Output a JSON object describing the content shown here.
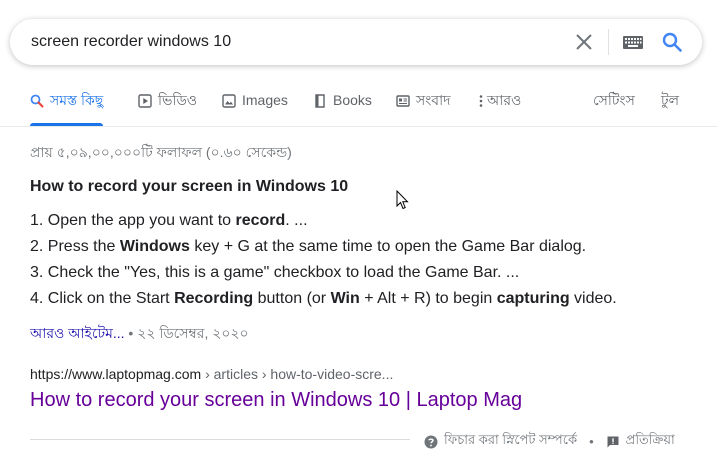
{
  "search": {
    "query": "screen recorder windows 10"
  },
  "tabs": [
    {
      "label": "সমস্ত কিছু",
      "icon": "search-icon"
    },
    {
      "label": "ভিডিও",
      "icon": "video-icon"
    },
    {
      "label": "Images",
      "icon": "image-icon"
    },
    {
      "label": "Books",
      "icon": "book-icon"
    },
    {
      "label": "সংবাদ",
      "icon": "news-icon"
    },
    {
      "label": "আরও",
      "icon": "more-vert-icon"
    }
  ],
  "tools": {
    "settings": "সেটিংস",
    "tools": "টুল"
  },
  "stats": "প্রায় ৫,০৯,০০,০০০টি ফলাফল (০.৬০ সেকেন্ড)",
  "snippet": {
    "title_parts": [
      "How to ",
      "record",
      " your ",
      "screen",
      " in ",
      "Windows 10"
    ],
    "steps": [
      [
        "1. Open the app you want to ",
        "record",
        ". ..."
      ],
      [
        "2. Press the ",
        "Windows",
        " key + G at the same time to open the Game Bar dialog."
      ],
      [
        "3. Check the \"Yes, this is a game\" checkbox to load the Game Bar. ..."
      ],
      [
        "4. Click on the Start ",
        "Recording",
        " button (or ",
        "Win",
        " + Alt + R) to begin ",
        "capturing",
        " video."
      ]
    ],
    "more_items": "আরও আইটেম...",
    "date": " • ২২ ডিসেম্বর, ২০২০"
  },
  "result": {
    "domain": "https://www.laptopmag.com",
    "breadcrumb": " › articles › how-to-video-scre...",
    "title": "How to record your screen in Windows 10 | Laptop Mag"
  },
  "footer": {
    "about_snippets": "ফিচার করা স্নিপেট সম্পর্কে",
    "separator": "•",
    "feedback": "প্রতিক্রিয়া"
  },
  "colors": {
    "accent": "#1a73e8",
    "link": "#1a0dab",
    "visited": "#660099",
    "muted": "#70757a"
  }
}
